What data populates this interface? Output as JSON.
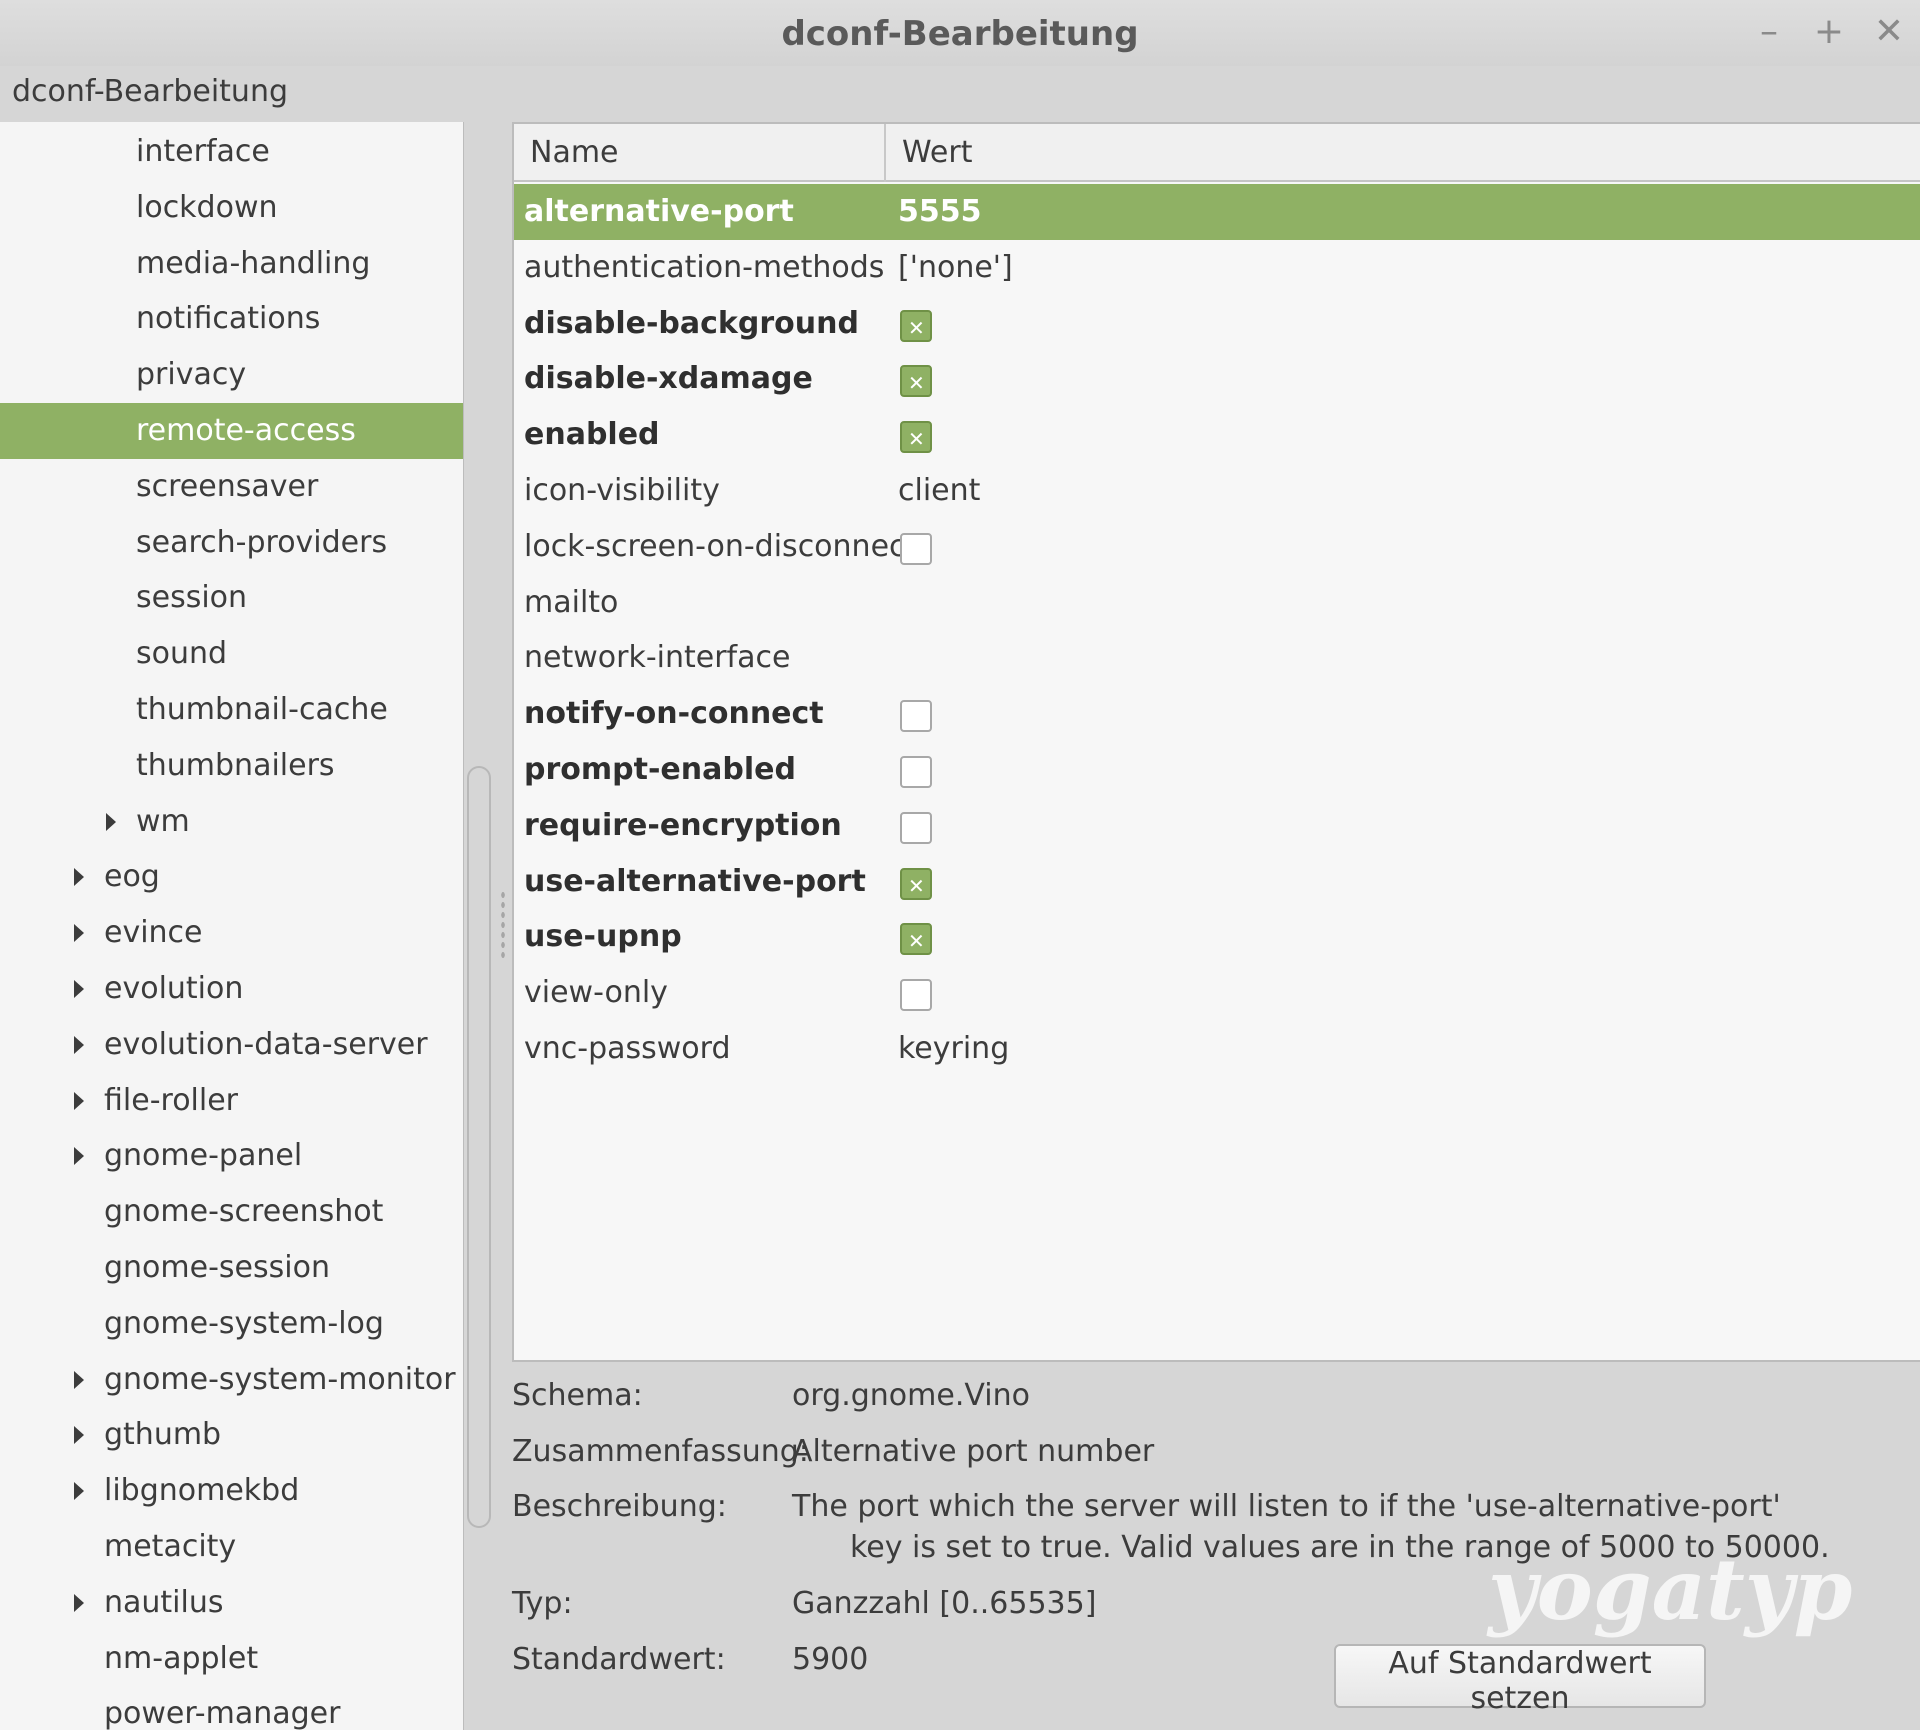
{
  "window": {
    "title": "dconf-Bearbeitung"
  },
  "window_controls": {
    "minimize": "–",
    "maximize": "+",
    "close": "✕"
  },
  "menubar": {
    "title": "dconf-Bearbeitung"
  },
  "tree": [
    {
      "label": "interface",
      "level": 2,
      "expandable": false,
      "selected": false
    },
    {
      "label": "lockdown",
      "level": 2,
      "expandable": false,
      "selected": false
    },
    {
      "label": "media-handling",
      "level": 2,
      "expandable": false,
      "selected": false
    },
    {
      "label": "notifications",
      "level": 2,
      "expandable": false,
      "selected": false
    },
    {
      "label": "privacy",
      "level": 2,
      "expandable": false,
      "selected": false
    },
    {
      "label": "remote-access",
      "level": 2,
      "expandable": false,
      "selected": true
    },
    {
      "label": "screensaver",
      "level": 2,
      "expandable": false,
      "selected": false
    },
    {
      "label": "search-providers",
      "level": 2,
      "expandable": false,
      "selected": false
    },
    {
      "label": "session",
      "level": 2,
      "expandable": false,
      "selected": false
    },
    {
      "label": "sound",
      "level": 2,
      "expandable": false,
      "selected": false
    },
    {
      "label": "thumbnail-cache",
      "level": 2,
      "expandable": false,
      "selected": false
    },
    {
      "label": "thumbnailers",
      "level": 2,
      "expandable": false,
      "selected": false
    },
    {
      "label": "wm",
      "level": 2,
      "expandable": true,
      "selected": false
    },
    {
      "label": "eog",
      "level": 1,
      "expandable": true,
      "selected": false
    },
    {
      "label": "evince",
      "level": 1,
      "expandable": true,
      "selected": false
    },
    {
      "label": "evolution",
      "level": 1,
      "expandable": true,
      "selected": false
    },
    {
      "label": "evolution-data-server",
      "level": 1,
      "expandable": true,
      "selected": false
    },
    {
      "label": "file-roller",
      "level": 1,
      "expandable": true,
      "selected": false
    },
    {
      "label": "gnome-panel",
      "level": 1,
      "expandable": true,
      "selected": false
    },
    {
      "label": "gnome-screenshot",
      "level": 1,
      "expandable": false,
      "selected": false
    },
    {
      "label": "gnome-session",
      "level": 1,
      "expandable": false,
      "selected": false
    },
    {
      "label": "gnome-system-log",
      "level": 1,
      "expandable": false,
      "selected": false
    },
    {
      "label": "gnome-system-monitor",
      "level": 1,
      "expandable": true,
      "selected": false
    },
    {
      "label": "gthumb",
      "level": 1,
      "expandable": true,
      "selected": false
    },
    {
      "label": "libgnomekbd",
      "level": 1,
      "expandable": true,
      "selected": false
    },
    {
      "label": "metacity",
      "level": 1,
      "expandable": false,
      "selected": false
    },
    {
      "label": "nautilus",
      "level": 1,
      "expandable": true,
      "selected": false
    },
    {
      "label": "nm-applet",
      "level": 1,
      "expandable": false,
      "selected": false
    },
    {
      "label": "power-manager",
      "level": 1,
      "expandable": false,
      "selected": false
    }
  ],
  "keylist": {
    "header": {
      "name": "Name",
      "value": "Wert"
    },
    "rows": [
      {
        "name": "alternative-port",
        "value": "5555",
        "kind": "text",
        "bold": true,
        "selected": true
      },
      {
        "name": "authentication-methods",
        "value": "['none']",
        "kind": "text",
        "bold": false,
        "selected": false
      },
      {
        "name": "disable-background",
        "kind": "bool",
        "checked": true,
        "bold": true,
        "selected": false
      },
      {
        "name": "disable-xdamage",
        "kind": "bool",
        "checked": true,
        "bold": true,
        "selected": false
      },
      {
        "name": "enabled",
        "kind": "bool",
        "checked": true,
        "bold": true,
        "selected": false
      },
      {
        "name": "icon-visibility",
        "value": "client",
        "kind": "text",
        "bold": false,
        "selected": false
      },
      {
        "name": "lock-screen-on-disconnect",
        "kind": "bool",
        "checked": false,
        "bold": false,
        "selected": false
      },
      {
        "name": "mailto",
        "value": "",
        "kind": "text",
        "bold": false,
        "selected": false
      },
      {
        "name": "network-interface",
        "value": "",
        "kind": "text",
        "bold": false,
        "selected": false
      },
      {
        "name": "notify-on-connect",
        "kind": "bool",
        "checked": false,
        "bold": true,
        "selected": false
      },
      {
        "name": "prompt-enabled",
        "kind": "bool",
        "checked": false,
        "bold": true,
        "selected": false
      },
      {
        "name": "require-encryption",
        "kind": "bool",
        "checked": false,
        "bold": true,
        "selected": false
      },
      {
        "name": "use-alternative-port",
        "kind": "bool",
        "checked": true,
        "bold": true,
        "selected": false
      },
      {
        "name": "use-upnp",
        "kind": "bool",
        "checked": true,
        "bold": true,
        "selected": false
      },
      {
        "name": "view-only",
        "kind": "bool",
        "checked": false,
        "bold": false,
        "selected": false
      },
      {
        "name": "vnc-password",
        "value": "keyring",
        "kind": "text",
        "bold": false,
        "selected": false
      }
    ]
  },
  "details": {
    "schema_label": "Schema:",
    "schema_value": "org.gnome.Vino",
    "summary_label": "Zusammenfassung:",
    "summary_value": "Alternative port number",
    "description_label": "Beschreibung:",
    "description_line1": "The port which the server will listen to if the 'use-alternative-port'",
    "description_line2": "key is set to true. Valid values are in the range of 5000 to 50000.",
    "type_label": "Typ:",
    "type_value": "Ganzzahl [0..65535]",
    "default_label": "Standardwert:",
    "default_value": "5900",
    "reset_button": "Auf Standardwert setzen"
  },
  "watermark": "yogatyp",
  "colors": {
    "accent": "#8fb164",
    "window_bg": "#d6d6d6",
    "list_bg": "#f7f7f7"
  }
}
